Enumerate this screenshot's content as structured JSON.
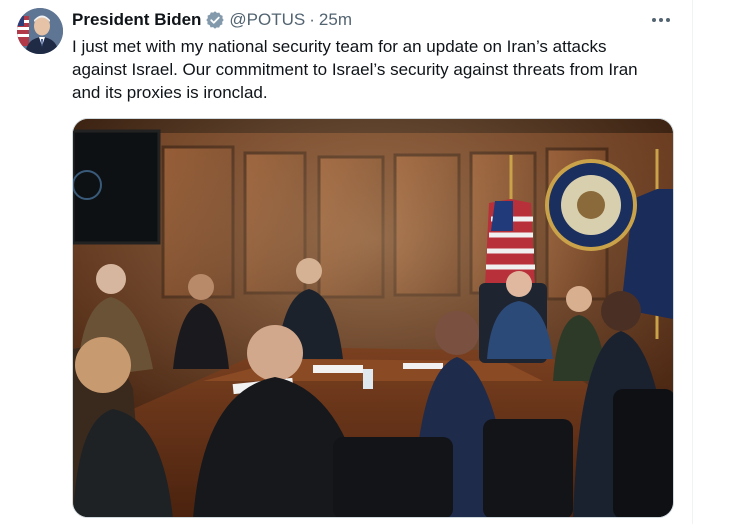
{
  "author": {
    "name": "President Biden",
    "handle": "@POTUS",
    "separator": "·",
    "time": "25m",
    "verified_icon": "verified-badge-icon"
  },
  "tweet": {
    "lines": [
      "I just met with my national security team for an update on Iran’s attacks",
      "against Israel. Our commitment to Israel’s security against threats from Iran",
      "and its proxies is ironclad."
    ]
  },
  "more_icon": "more-horizontal-icon",
  "colors": {
    "text_primary": "#0f1419",
    "text_secondary": "#536471",
    "border": "#cfd9de",
    "verified": "#829aab"
  }
}
